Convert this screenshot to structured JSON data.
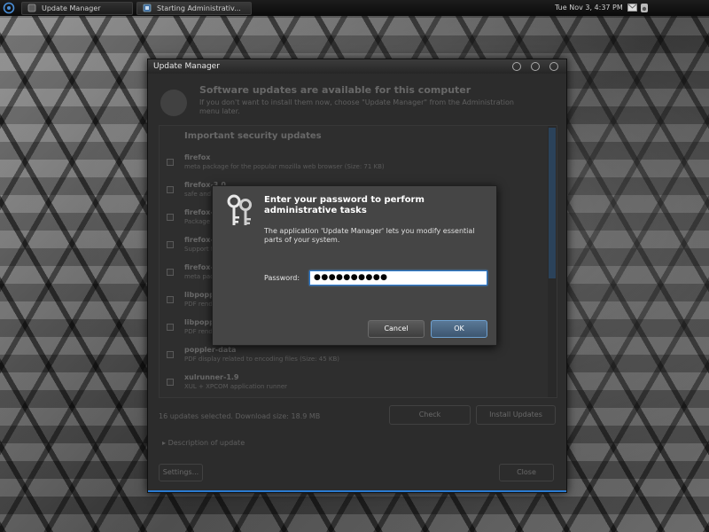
{
  "panel": {
    "tasks": [
      {
        "label": "Update Manager",
        "icon": "update-icon"
      },
      {
        "label": "Starting Administrativ...",
        "icon": "admin-icon"
      }
    ],
    "clock": "Tue Nov  3,  4:37 PM",
    "icons": [
      "mail-icon",
      "volume-icon"
    ]
  },
  "update_window": {
    "title": "Update Manager",
    "heading": "Software updates are available for this computer",
    "description": "If you don't want to install them now, choose \"Update Manager\" from the Administration menu later.",
    "list_header": "Important security updates",
    "packages": [
      {
        "name": "firefox",
        "desc": "meta package for the popular mozilla web browser (Size: 71 KB)"
      },
      {
        "name": "firefox-3.0",
        "desc": "safe and easy web browser from Mozilla"
      },
      {
        "name": "firefox-3.0-branding",
        "desc": "Package that ships the firefox branding"
      },
      {
        "name": "firefox-3.0-gnome-support",
        "desc": "Support for Gnome in Mozilla Firefox"
      },
      {
        "name": "firefox-gnome-support",
        "desc": "meta package pulling in the gnome support"
      },
      {
        "name": "libpoppler3",
        "desc": "PDF rendering library"
      },
      {
        "name": "libpoppler-glib3",
        "desc": "PDF rendering library (GLib-based shared library)"
      },
      {
        "name": "poppler-data",
        "desc": "PDF display related to encoding files (Size: 45 KB)"
      },
      {
        "name": "xulrunner-1.9",
        "desc": "XUL + XPCOM application runner"
      }
    ],
    "summary": "16 updates selected. Download size: 18.9 MB",
    "check_label": "Check",
    "install_label": "Install Updates",
    "description_expander": "Description of update",
    "settings_label": "Settings...",
    "close_label": "Close"
  },
  "password_dialog": {
    "title": "Enter your password to perform administrative tasks",
    "message": "The application 'Update Manager' lets you modify essential parts of your system.",
    "password_label": "Password:",
    "password_value": "●●●●●●●●●●",
    "cancel_label": "Cancel",
    "ok_label": "OK",
    "icon": "keys-icon"
  },
  "colors": {
    "accent": "#2a7bd1",
    "dialog_bg": "#454545",
    "panel_bg": "#111111"
  }
}
